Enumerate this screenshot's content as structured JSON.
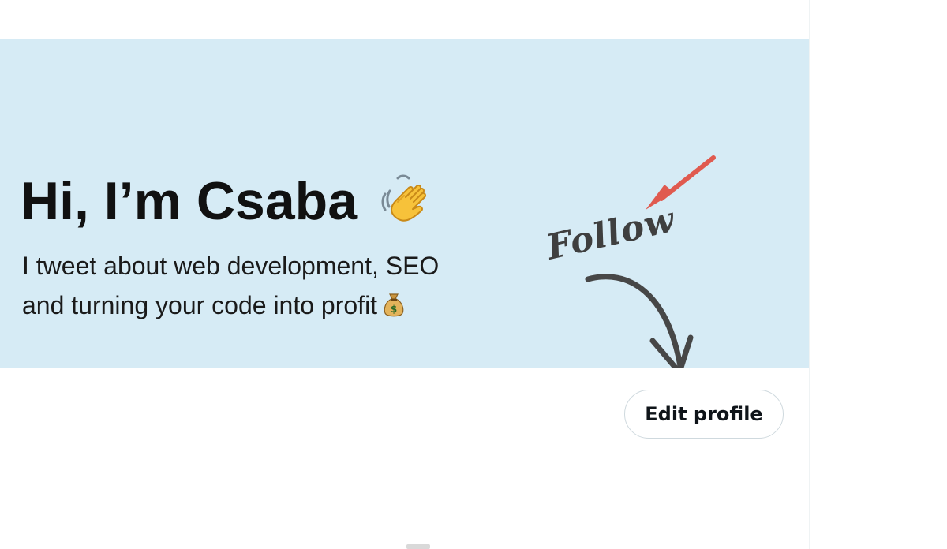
{
  "banner": {
    "headline": "Hi, I’m Csaba",
    "wave_emoji": "waving-hand-icon",
    "bio_line_1": "I tweet about web development, SEO",
    "bio_line_2": "and turning your code into profit",
    "money_emoji": "money-bag-icon",
    "follow_text": "Follow",
    "background_color": "#d6ebf5",
    "arrow_color": "#e05a4f"
  },
  "profile": {
    "edit_profile_label": "Edit profile"
  }
}
